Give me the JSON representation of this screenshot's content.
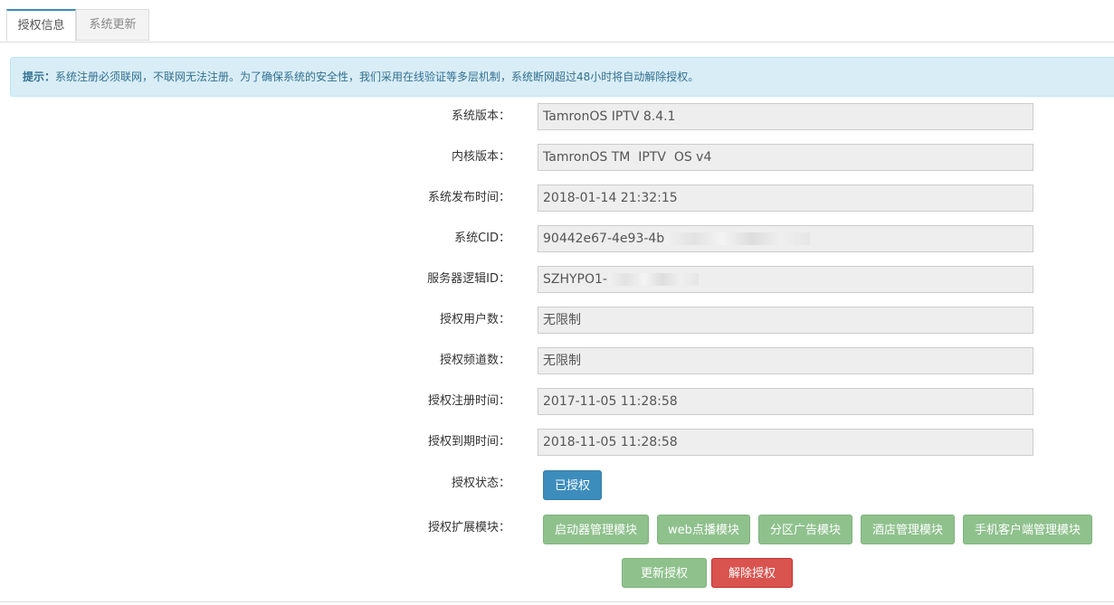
{
  "tabs": [
    {
      "label": "授权信息",
      "active": true
    },
    {
      "label": "系统更新",
      "active": false
    }
  ],
  "notice": {
    "prefix": "提示：",
    "text": "系统注册必须联网，不联网无法注册。为了确保系统的安全性，我们采用在线验证等多层机制，系统断网超过48小时将自动解除授权。"
  },
  "fields": [
    {
      "label": "系统版本：",
      "value": "TamronOS IPTV 8.4.1"
    },
    {
      "label": "内核版本：",
      "value": "TamronOS TM  IPTV  OS v4"
    },
    {
      "label": "系统发布时间：",
      "value": "2018-01-14 21:32:15"
    },
    {
      "label": "系统CID：",
      "value": "90442e67-4e93-4b",
      "redacted": true
    },
    {
      "label": "服务器逻辑ID：",
      "value": "SZHYPO1-",
      "redacted": true
    },
    {
      "label": "授权用户数：",
      "value": "无限制"
    },
    {
      "label": "授权频道数：",
      "value": "无限制"
    },
    {
      "label": "授权注册时间：",
      "value": "2017-11-05 11:28:58"
    },
    {
      "label": "授权到期时间：",
      "value": "2018-11-05 11:28:58"
    }
  ],
  "status": {
    "label": "授权状态：",
    "badge": "已授权"
  },
  "modules": {
    "label": "授权扩展模块：",
    "items": [
      "启动器管理模块",
      "web点播模块",
      "分区广告模块",
      "酒店管理模块",
      "手机客户端管理模块"
    ]
  },
  "actions": {
    "update": "更新授权",
    "remove": "解除授权"
  },
  "colors": {
    "primary": "#3c8dbc",
    "success": "#8fc18d",
    "danger": "#d9534f",
    "info_bg": "#d9edf7"
  }
}
